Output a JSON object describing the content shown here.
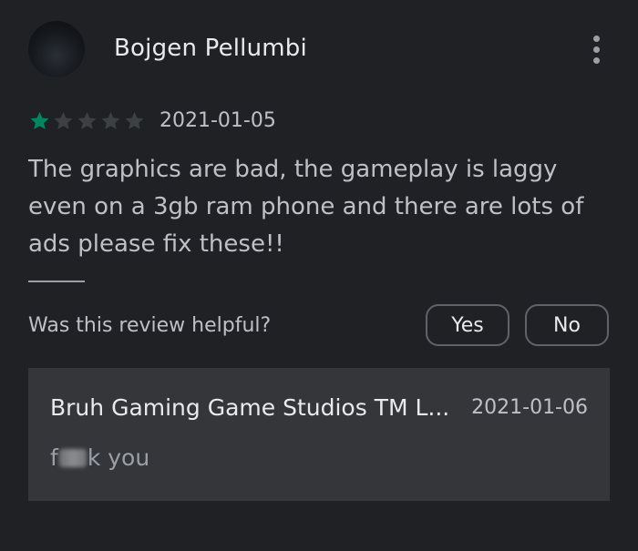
{
  "review": {
    "author": "Bojgen Pellumbi",
    "rating": 1,
    "max_rating": 5,
    "date": "2021-01-05",
    "text": "The graphics are bad, the gameplay is laggy even on a 3gb ram phone and there are lots of ads please fix these!!",
    "more_icon": "more-vert-icon",
    "star_filled_color": "#01875f",
    "star_empty_color": "#3c4043"
  },
  "helpful": {
    "question": "Was this review helpful?",
    "yes_label": "Yes",
    "no_label": "No"
  },
  "developer_reply": {
    "name": "Bruh Gaming Game Studios TM L...",
    "date": "2021-01-06",
    "text_before": "f",
    "text_after": "k you"
  }
}
